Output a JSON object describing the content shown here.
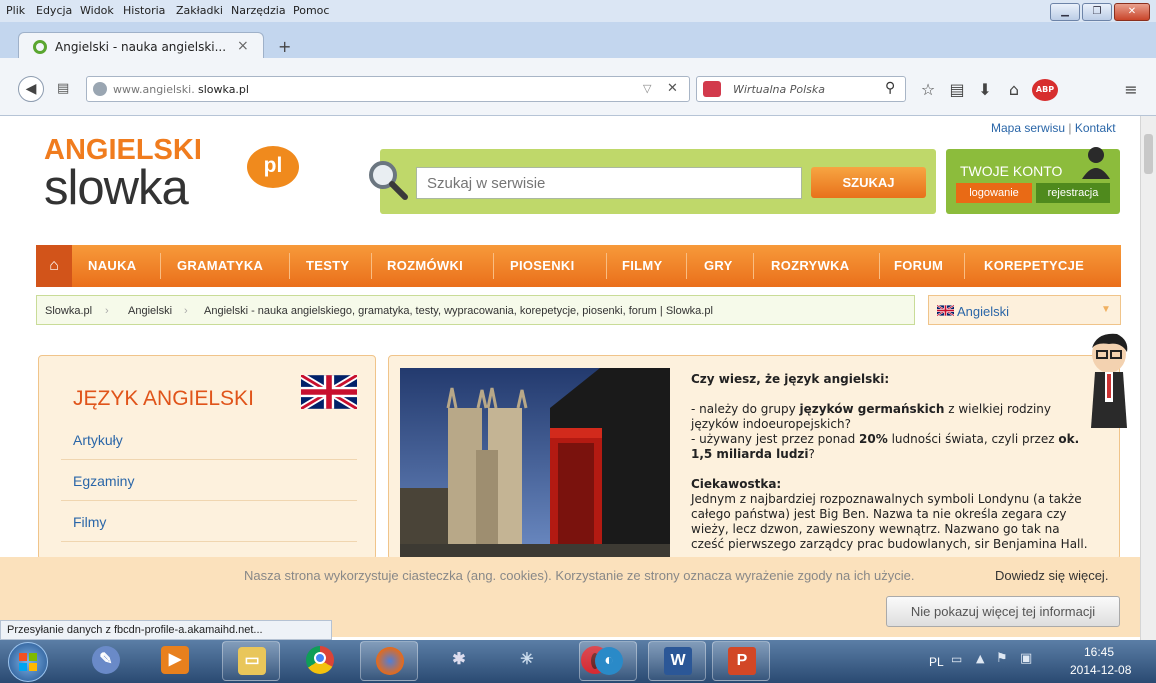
{
  "browser": {
    "menu": [
      "Plik",
      "Edycja",
      "Widok",
      "Historia",
      "Zakładki",
      "Narzędzia",
      "Pomoc"
    ],
    "tab_title": "Angielski - nauka angielski...",
    "tab_close": "×",
    "new_tab": "+",
    "url_prefix": "www.angielski.",
    "url_domain": "slowka.pl",
    "search_engine": "Wirtualna Polska",
    "status": "Przesyłanie danych z fbcdn-profile-a.akamaihd.net..."
  },
  "site": {
    "logo_top": "ANGIELSKI",
    "logo_main": "slowka",
    "logo_pl": "pl",
    "sitemap": "Mapa serwisu",
    "contact": "Kontakt",
    "search_placeholder": "Szukaj w serwisie",
    "search_button": "SZUKAJ",
    "account_title": "TWOJE KONTO",
    "login": "logowanie",
    "register": "rejestracja",
    "nav": [
      "NAUKA",
      "GRAMATYKA",
      "TESTY",
      "ROZMÓWKI",
      "PIOSENKI",
      "FILMY",
      "GRY",
      "ROZRYWKA",
      "FORUM",
      "KOREPETYCJE"
    ],
    "breadcrumbs": [
      "Slowka.pl",
      "Angielski",
      "Angielski - nauka angielskiego, gramatyka, testy, wypracowania, korepetycje, piosenki, forum | Slowka.pl"
    ],
    "language": "Angielski",
    "left_title": "JĘZYK ANGIELSKI",
    "left_links": [
      "Artykuły",
      "Egzaminy",
      "Filmy"
    ],
    "facts": {
      "heading": "Czy wiesz, że język angielski:",
      "l1a": "- należy do grupy ",
      "l1b": "języków germańskich",
      "l1c": " z wielkiej rodziny języków indoeuropejskich?",
      "l2a": "- używany jest przez ponad ",
      "l2b": "20%",
      "l2c": " ludności świata, czyli przez ",
      "l2d": "ok. 1,5 miliarda ludzi",
      "l2e": "?",
      "curiosity": "Ciekawostka:",
      "body": "Jednym z najbardziej rozpoznawalnych symboli Londynu (a także całego państwa) jest Big Ben. Nazwa ta nie określa zegara czy wieży, lecz dzwon, zawieszony wewnątrz. Nazwano go tak na cześć pierwszego zarządcy prac budowlanych, sir Benjamina Hall."
    },
    "cookie_text": "Nasza strona wykorzystuje ciasteczka (ang. cookies). Korzystanie ze strony oznacza wyrażenie zgody na ich użycie.",
    "cookie_link": "Dowiedz się więcej.",
    "cookie_button": "Nie pokazuj więcej tej informacji"
  },
  "taskbar": {
    "lang": "PL",
    "time": "16:45",
    "date": "2014-12-08"
  },
  "colors": {
    "accent": "#ea6f1b",
    "green": "#8cbc3c",
    "panel": "#fdf1dd"
  }
}
